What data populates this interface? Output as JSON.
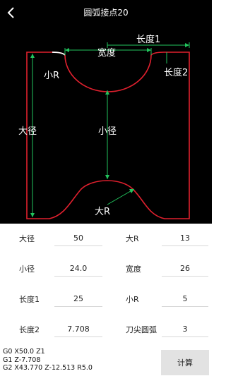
{
  "header": {
    "title": "圆弧接点20"
  },
  "diagram": {
    "labels": {
      "length1": "长度1",
      "width": "宽度",
      "length2": "长度2",
      "small_r": "小R",
      "large_diameter": "大径",
      "small_diameter": "小径",
      "large_r": "大R"
    },
    "colors": {
      "outline": "#e0202e",
      "dimension": "#22c55e",
      "background": "#000000"
    }
  },
  "params": {
    "rows": [
      {
        "left_label": "大径",
        "left_value": "50",
        "right_label": "大R",
        "right_value": "13"
      },
      {
        "left_label": "小径",
        "left_value": "24.0",
        "right_label": "宽度",
        "right_value": "26"
      },
      {
        "left_label": "长度1",
        "left_value": "25",
        "right_label": "小R",
        "right_value": "5"
      },
      {
        "left_label": "长度2",
        "left_value": "7.708",
        "right_label": "刀尖圆弧",
        "right_value": "3"
      }
    ]
  },
  "gcode": {
    "lines": [
      "G0 X50.0 Z1",
      "G1 Z-7.708",
      "G2 X43.770 Z-12.513 R5.0"
    ]
  },
  "calc_button": {
    "label": "计算"
  }
}
